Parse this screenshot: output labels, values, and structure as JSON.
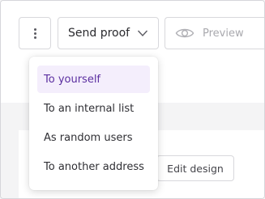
{
  "toolbar": {
    "more_icon": "vertical-ellipsis-icon",
    "send_proof_label": "Send proof",
    "send_proof_icon": "chevron-down-icon",
    "preview_label": "Preview",
    "preview_icon": "eye-icon"
  },
  "send_proof_menu": {
    "items": [
      {
        "label": "To yourself",
        "highlighted": true
      },
      {
        "label": "To an internal list",
        "highlighted": false
      },
      {
        "label": "As random users",
        "highlighted": false
      },
      {
        "label": "To another address",
        "highlighted": false
      }
    ]
  },
  "content": {
    "edit_design_label": "Edit design"
  },
  "colors": {
    "highlight_bg": "#f4eefc",
    "highlight_text": "#5b2fa0",
    "border": "#d8d8dc"
  }
}
